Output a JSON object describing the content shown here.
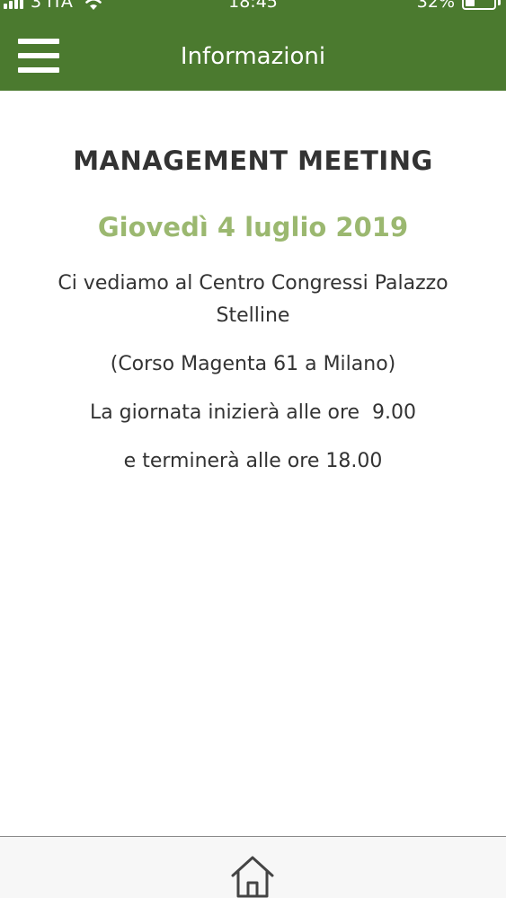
{
  "status_bar": {
    "carrier": "3 ITA",
    "time": "18:45",
    "battery_percent": "32%",
    "battery_level": 0.32,
    "icons": [
      "signal-icon",
      "wifi-icon",
      "battery-icon"
    ]
  },
  "header": {
    "title": "Informazioni",
    "menu_icon": "hamburger-menu-icon",
    "background_color": "#4b7a2f"
  },
  "event": {
    "title": "MANAGEMENT MEETING",
    "date": "Giovedì 4 luglio 2019",
    "date_color": "#9bb870",
    "venue_text": "Ci vediamo al Centro Congressi Palazzo Stelline",
    "address_text": "(Corso Magenta 61 a Milano)",
    "start_text": "La giornata inizierà alle ore  9.00",
    "end_text": "e terminerà alle ore 18.00"
  },
  "bottom_nav": {
    "home_icon": "home-icon"
  }
}
